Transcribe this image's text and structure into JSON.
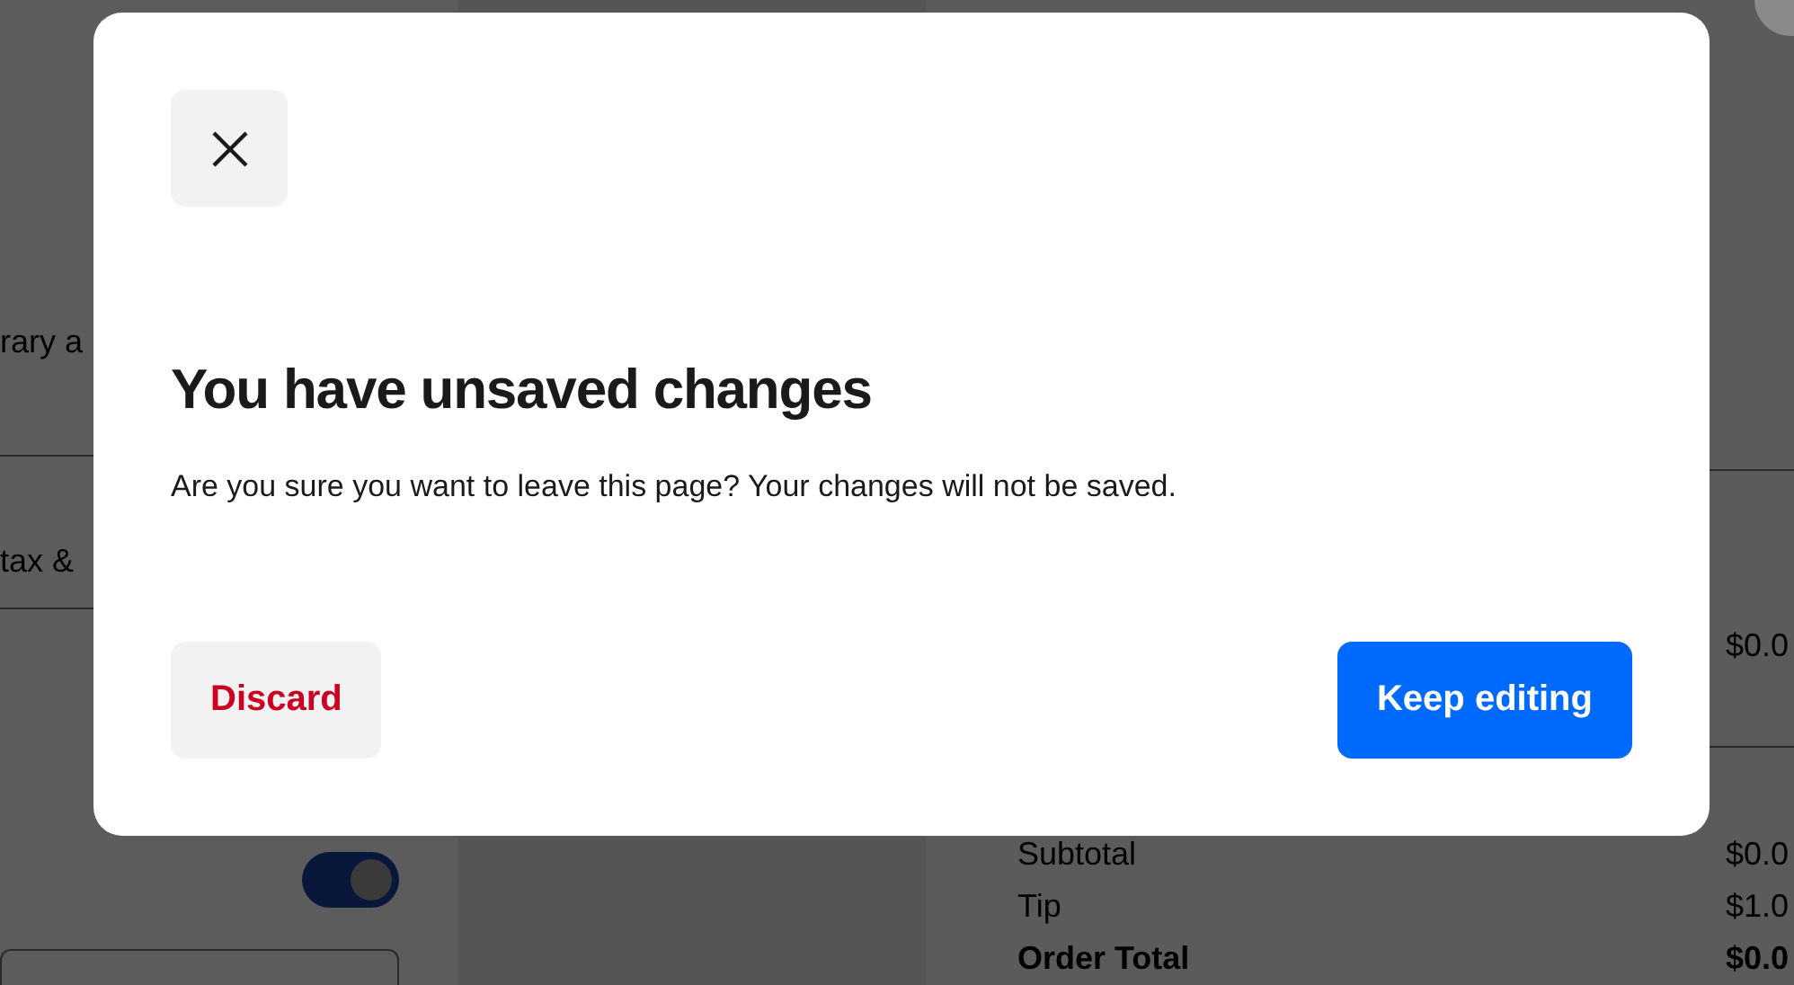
{
  "background": {
    "left_texts": [
      "rary a",
      "tax &"
    ],
    "toggle": {
      "on": true
    },
    "summary": [
      {
        "kind": "amount",
        "value": "$0.0"
      },
      {
        "kind": "line",
        "label": "Subtotal",
        "value": "$0.0"
      },
      {
        "kind": "line",
        "label": "Tip",
        "value": "$1.0"
      },
      {
        "kind": "total",
        "label": "Order Total",
        "value": "$0.0"
      }
    ]
  },
  "dialog": {
    "title": "You have unsaved changes",
    "message": "Are you sure you want to leave this page? Your changes will not be saved.",
    "buttons": [
      {
        "label": "Discard",
        "kind": "secondary"
      },
      {
        "label": "Keep editing",
        "kind": "primary"
      }
    ]
  }
}
